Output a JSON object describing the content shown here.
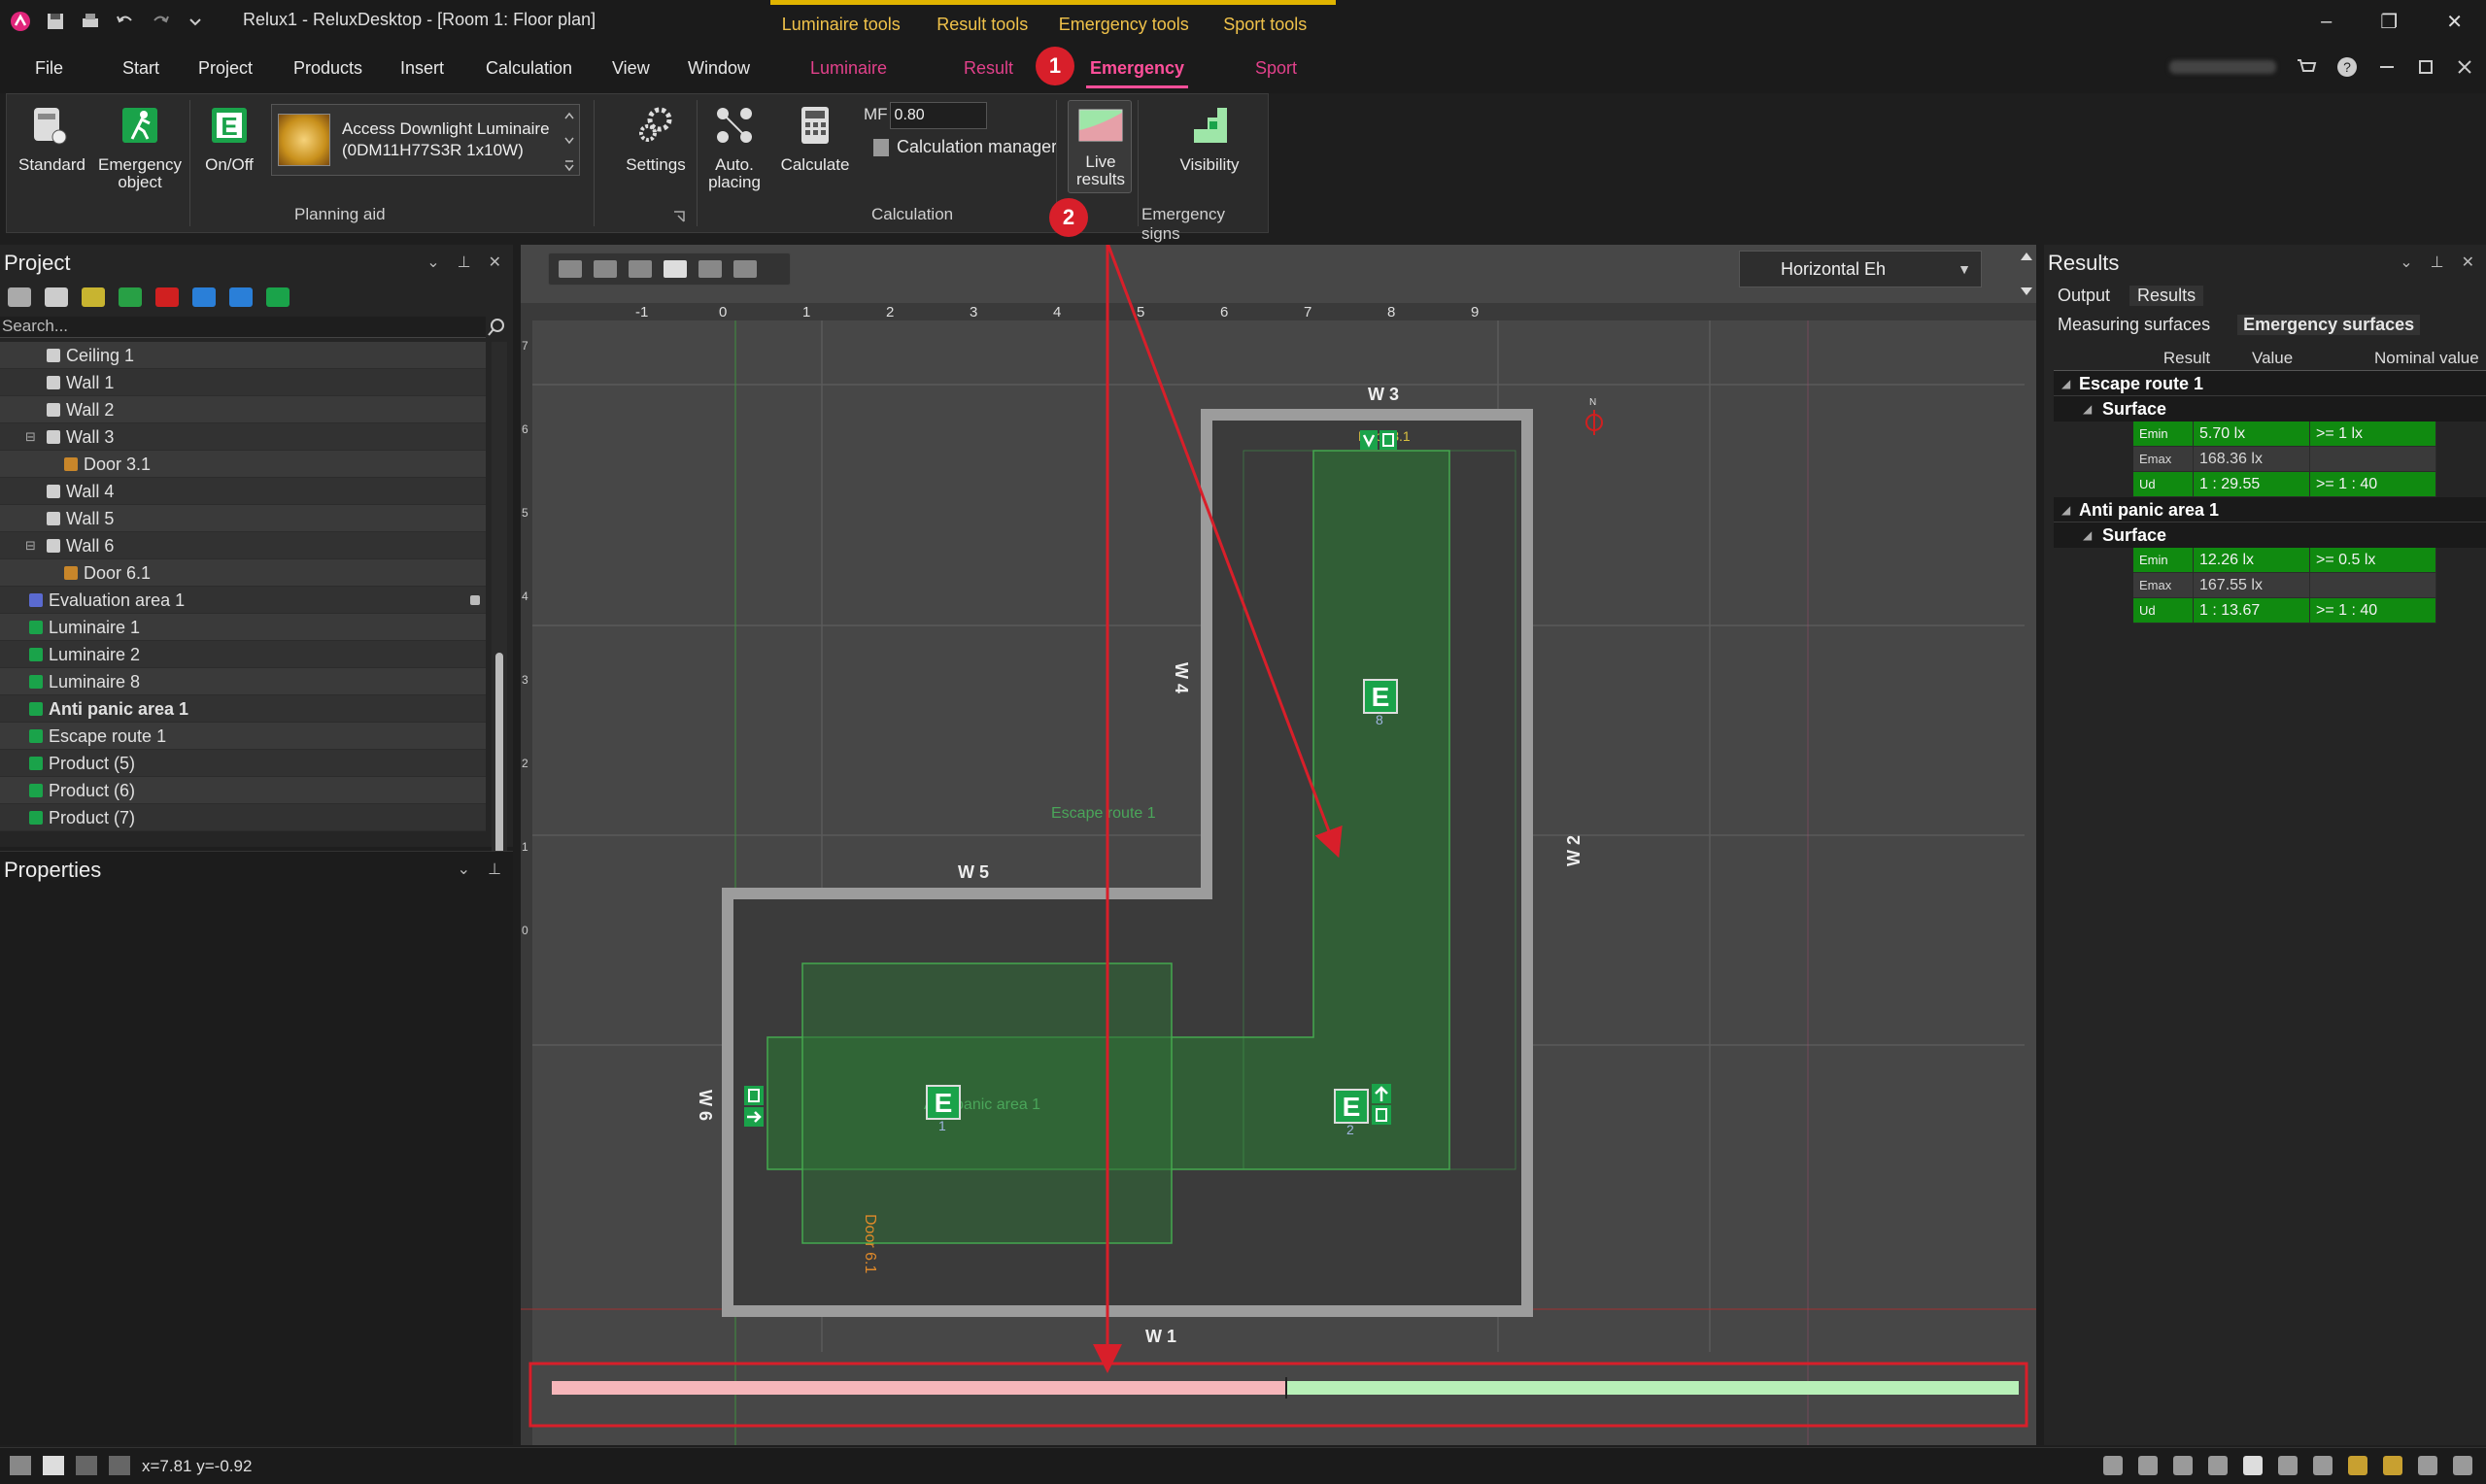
{
  "window": {
    "title": "Relux1 - ReluxDesktop - [Room 1: Floor plan]",
    "context_tabs": [
      "Luminaire tools",
      "Result tools",
      "Emergency tools",
      "Sport tools"
    ],
    "minimize": "–",
    "restore": "❐",
    "close": "✕"
  },
  "menu": {
    "items": [
      "File",
      "Start",
      "Project",
      "Products",
      "Insert",
      "Calculation",
      "View",
      "Window"
    ],
    "context_items": [
      "Luminaire",
      "Result",
      "Emergency",
      "Sport"
    ],
    "active": "Emergency"
  },
  "ribbon": {
    "standard": "Standard",
    "emergency_object": "Emergency object",
    "on_off": "On/Off",
    "luminaire_name": "Access Downlight Luminaire",
    "luminaire_code": "(0DM11H77S3R 1x10W)",
    "settings": "Settings",
    "auto_placing": "Auto. placing",
    "calculate": "Calculate",
    "mf_label": "MF",
    "mf_value": "0.80",
    "calculation_manager": "Calculation manager",
    "live_results": "Live results",
    "visibility": "Visibility",
    "group_planning": "Planning aid",
    "group_calculation": "Calculation",
    "group_signs": "Emergency signs"
  },
  "badges": [
    "1",
    "2"
  ],
  "project": {
    "title": "Project",
    "search_placeholder": "Search...",
    "tree": [
      {
        "label": "Ceiling 1",
        "indent": 2,
        "icon": "ceiling"
      },
      {
        "label": "Wall 1",
        "indent": 2,
        "icon": "wall"
      },
      {
        "label": "Wall 2",
        "indent": 2,
        "icon": "wall"
      },
      {
        "label": "Wall 3",
        "indent": 2,
        "icon": "wall",
        "expanded": true
      },
      {
        "label": "Door 3.1",
        "indent": 3,
        "icon": "door"
      },
      {
        "label": "Wall 4",
        "indent": 2,
        "icon": "wall"
      },
      {
        "label": "Wall 5",
        "indent": 2,
        "icon": "wall"
      },
      {
        "label": "Wall 6",
        "indent": 2,
        "icon": "wall",
        "expanded": true
      },
      {
        "label": "Door 6.1",
        "indent": 3,
        "icon": "door"
      },
      {
        "label": "Evaluation area 1",
        "indent": 1,
        "icon": "eval",
        "locked": true
      },
      {
        "label": "Luminaire  1",
        "indent": 1,
        "icon": "lum"
      },
      {
        "label": "Luminaire  2",
        "indent": 1,
        "icon": "lum"
      },
      {
        "label": "Luminaire  8",
        "indent": 1,
        "icon": "lum"
      },
      {
        "label": "Anti panic area 1",
        "indent": 1,
        "icon": "panic",
        "bold": true
      },
      {
        "label": "Escape route 1",
        "indent": 1,
        "icon": "route"
      },
      {
        "label": "Product (5)",
        "indent": 1,
        "icon": "prod"
      },
      {
        "label": "Product (6)",
        "indent": 1,
        "icon": "prod"
      },
      {
        "label": "Product (7)",
        "indent": 1,
        "icon": "prod"
      }
    ]
  },
  "properties": {
    "title": "Properties"
  },
  "viewport": {
    "view_mode": "Horizontal Eh",
    "ruler_x": [
      "-1",
      "0",
      "1",
      "2",
      "3",
      "4",
      "5",
      "6",
      "7",
      "8",
      "9"
    ],
    "ruler_y": [
      "7",
      "6",
      "5",
      "4",
      "3",
      "2",
      "1",
      "0"
    ],
    "walls": [
      "W 1",
      "W 2",
      "W 3",
      "W 4",
      "W 5",
      "W 6"
    ],
    "escape_route_label": "Escape route 1",
    "panic_area_label": "Anti panic area 1",
    "door_label": "Door 6.1",
    "door3_label": "Door 3.1",
    "luminaire_numbers": [
      "1",
      "2",
      "8"
    ],
    "sign_letter": "E",
    "compass": "N"
  },
  "results": {
    "title": "Results",
    "tabs": [
      "Output",
      "Results"
    ],
    "subtabs": [
      "Measuring surfaces",
      "Emergency surfaces"
    ],
    "columns": [
      "Result",
      "Value",
      "Nominal value"
    ],
    "groups": [
      {
        "name": "Escape route 1",
        "surface": "Surface",
        "rows": [
          {
            "k": "Emin",
            "v": "5.70 lx",
            "n": ">= 1 lx",
            "ok": true
          },
          {
            "k": "Emax",
            "v": "168.36 lx",
            "n": "",
            "ok": false
          },
          {
            "k": "Ud",
            "v": "1 : 29.55",
            "n": ">= 1 : 40",
            "ok": true
          }
        ]
      },
      {
        "name": "Anti panic area 1",
        "surface": "Surface",
        "rows": [
          {
            "k": "Emin",
            "v": "12.26 lx",
            "n": ">= 0.5 lx",
            "ok": true
          },
          {
            "k": "Emax",
            "v": "167.55 lx",
            "n": "",
            "ok": false
          },
          {
            "k": "Ud",
            "v": "1 : 13.67",
            "n": ">= 1 : 40",
            "ok": true
          }
        ]
      }
    ]
  },
  "status": {
    "coords": "x=7.81 y=-0.92"
  },
  "colors": {
    "accent": "#ff4f9a",
    "context": "#f0c24a",
    "ok_green": "#108a10",
    "annot_red": "#d81f2a",
    "route_green": "#2f7d3a"
  }
}
